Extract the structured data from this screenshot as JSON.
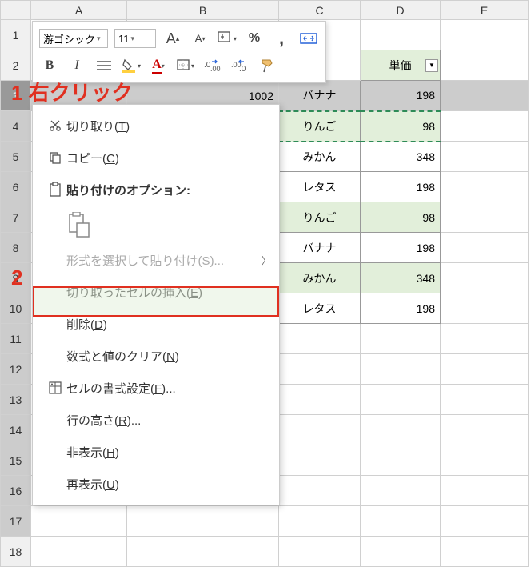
{
  "columns": [
    "A",
    "B",
    "C",
    "D",
    "E"
  ],
  "rows": [
    "1",
    "2",
    "3",
    "4",
    "5",
    "6",
    "7",
    "8",
    "9",
    "10",
    "11",
    "12",
    "13",
    "14",
    "15",
    "16",
    "17",
    "18"
  ],
  "header": {
    "price_label": "単価"
  },
  "cells": {
    "b3": "1002",
    "c3": "バナナ",
    "d3": "198",
    "c4": "りんご",
    "d4": "98",
    "c5": "みかん",
    "d5": "348",
    "c6": "レタス",
    "d6": "198",
    "c7": "りんご",
    "d7": "98",
    "c8": "バナナ",
    "d8": "198",
    "c9": "みかん",
    "d9": "348",
    "c10": "レタス",
    "d10": "198"
  },
  "toolbar": {
    "font_name": "游ゴシック",
    "font_size": "11"
  },
  "context_menu": {
    "cut": "切り取り(T)",
    "copy": "コピー(C)",
    "paste_options": "貼り付けのオプション:",
    "paste_special": "形式を選択して貼り付け(S)...",
    "insert_cut": "切り取ったセルの挿入(E)",
    "delete": "削除(D)",
    "clear": "数式と値のクリア(N)",
    "format": "セルの書式設定(F)...",
    "row_height": "行の高さ(R)...",
    "hide": "非表示(H)",
    "unhide": "再表示(U)"
  },
  "annotations": {
    "a1": "1 右クリック",
    "a2": "2"
  }
}
